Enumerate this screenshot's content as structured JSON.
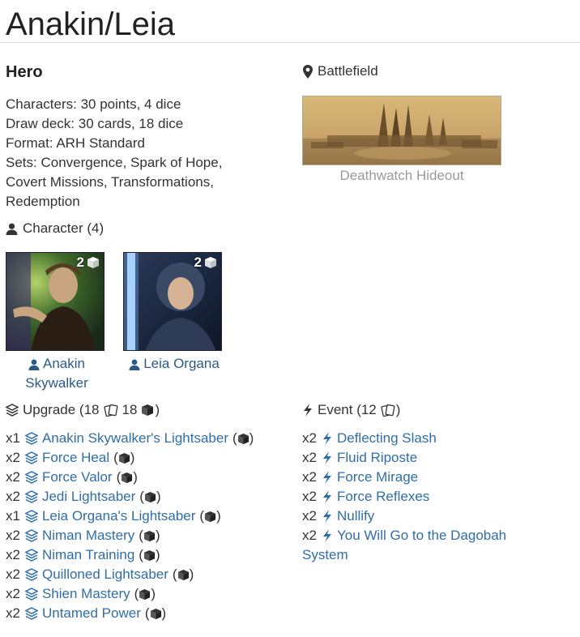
{
  "deck": {
    "title": "Anakin/Leia",
    "affiliation": "Hero",
    "info": [
      "Characters: 30 points, 4 dice",
      "Draw deck: 30 cards, 18 dice",
      "Format: ARH Standard",
      "Sets: Convergence, Spark of Hope,",
      "Covert Missions, Transformations,",
      "Redemption"
    ]
  },
  "battlefield": {
    "header": "Battlefield",
    "name": "Deathwatch Hideout"
  },
  "characters": {
    "header": "Character (4)",
    "items": [
      {
        "dice": "2",
        "name_line1": "Anakin",
        "name_line2": "Skywalker"
      },
      {
        "dice": "2",
        "name_line1": "Leia Organa",
        "name_line2": ""
      }
    ]
  },
  "upgrades": {
    "header_prefix": "Upgrade (18",
    "header_mid": "18",
    "header_suffix": ")",
    "items": [
      {
        "qty": "x1",
        "name": "Anakin Skywalker's Lightsaber"
      },
      {
        "qty": "x2",
        "name": "Force Heal"
      },
      {
        "qty": "x2",
        "name": "Force Valor"
      },
      {
        "qty": "x2",
        "name": "Jedi Lightsaber"
      },
      {
        "qty": "x1",
        "name": "Leia Organa's Lightsaber"
      },
      {
        "qty": "x2",
        "name": "Niman Mastery"
      },
      {
        "qty": "x2",
        "name": "Niman Training"
      },
      {
        "qty": "x2",
        "name": "Quilloned Lightsaber"
      },
      {
        "qty": "x2",
        "name": "Shien Mastery"
      },
      {
        "qty": "x2",
        "name": "Untamed Power"
      }
    ]
  },
  "events": {
    "header_prefix": "Event (12",
    "header_suffix": ")",
    "items": [
      {
        "qty": "x2",
        "name": "Deflecting Slash"
      },
      {
        "qty": "x2",
        "name": "Fluid Riposte"
      },
      {
        "qty": "x2",
        "name": "Force Mirage"
      },
      {
        "qty": "x2",
        "name": "Force Reflexes"
      },
      {
        "qty": "x2",
        "name": "Nullify"
      },
      {
        "qty": "x2",
        "name": "You Will Go to the Dagobah"
      }
    ],
    "wrap_line": "System"
  },
  "icons": {
    "person": "person-icon",
    "map_marker": "map-marker-icon",
    "layers": "layers-icon",
    "bolt": "lightning-bolt-icon",
    "cards": "cards-icon",
    "die": "die-icon"
  },
  "colors": {
    "link": "#2f6ea8",
    "text": "#333333",
    "title": "#222222",
    "muted": "#999999"
  }
}
